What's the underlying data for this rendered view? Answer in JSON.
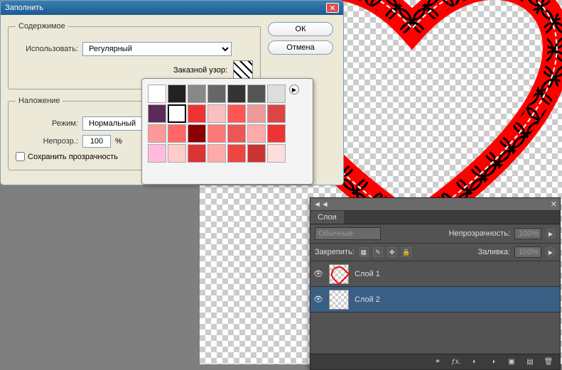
{
  "dialog": {
    "title": "Заполнить",
    "content_legend": "Содержимое",
    "use_label": "Использовать:",
    "use_value": "Регулярный",
    "custom_label": "Заказной узор:",
    "overlay_legend": "Наложение",
    "mode_label": "Режим:",
    "mode_value": "Нормальный",
    "opacity_label": "Непрозр.:",
    "opacity_value": "100",
    "opacity_pct": "%",
    "preserve_label": "Сохранить прозрачность",
    "ok": "ОК",
    "cancel": "Отмена"
  },
  "popup": {
    "patterns": [
      {
        "c": "#fff"
      },
      {
        "c": "#222"
      },
      {
        "c": "#888"
      },
      {
        "c": "#666"
      },
      {
        "c": "#333"
      },
      {
        "c": "#555"
      },
      {
        "c": "#ddd"
      },
      {
        "c": "#5a2a5a"
      },
      {
        "c": "#fff",
        "sel": true
      },
      {
        "c": "#e33"
      },
      {
        "c": "#f8c0c0"
      },
      {
        "c": "#f55"
      },
      {
        "c": "#ee9999"
      },
      {
        "c": "#d44"
      },
      {
        "c": "#f99"
      },
      {
        "c": "#f66"
      },
      {
        "c": "#8b0000"
      },
      {
        "c": "#f77"
      },
      {
        "c": "#e55"
      },
      {
        "c": "#faa"
      },
      {
        "c": "#e33"
      },
      {
        "c": "#fbd"
      },
      {
        "c": "#fcc"
      },
      {
        "c": "#d33"
      },
      {
        "c": "#faa"
      },
      {
        "c": "#e44"
      },
      {
        "c": "#c33"
      },
      {
        "c": "#fdd"
      }
    ]
  },
  "layers": {
    "tab": "Слои",
    "blend_value": "Обычные",
    "opacity_label": "Непрозрачность:",
    "opacity_value": "100%",
    "lock_label": "Закрепить:",
    "fill_label": "Заливка:",
    "fill_value": "100%",
    "items": [
      {
        "name": "Слой 1",
        "sel": false,
        "heart": true
      },
      {
        "name": "Слой 2",
        "sel": true,
        "heart": false
      }
    ]
  }
}
